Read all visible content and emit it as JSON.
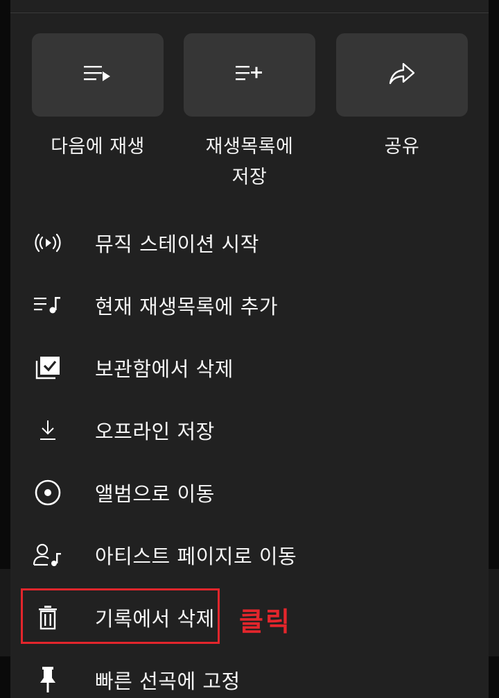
{
  "actions": [
    {
      "id": "play-next",
      "icon": "queue-play-icon",
      "label_lines": [
        "다음에 재생"
      ]
    },
    {
      "id": "save-playlist",
      "icon": "playlist-add-icon",
      "label_lines": [
        "재생목록에",
        "저장"
      ]
    },
    {
      "id": "share",
      "icon": "share-icon",
      "label_lines": [
        "공유"
      ]
    }
  ],
  "menu": [
    {
      "id": "start-radio",
      "icon": "radio-icon",
      "label": "뮤직 스테이션 시작"
    },
    {
      "id": "add-to-queue",
      "icon": "queue-music-icon",
      "label": "현재 재생목록에 추가"
    },
    {
      "id": "remove-library",
      "icon": "library-check-icon",
      "label": "보관함에서 삭제"
    },
    {
      "id": "download",
      "icon": "download-icon",
      "label": "오프라인 저장"
    },
    {
      "id": "go-album",
      "icon": "album-icon",
      "label": "앨범으로 이동"
    },
    {
      "id": "go-artist",
      "icon": "artist-icon",
      "label": "아티스트 페이지로 이동"
    },
    {
      "id": "remove-history",
      "icon": "trash-icon",
      "label": "기록에서 삭제"
    },
    {
      "id": "pin-speed-dial",
      "icon": "pin-icon",
      "label": "빠른 선곡에 고정"
    }
  ],
  "annotation": {
    "text": "클릭",
    "color": "#e3262c"
  },
  "colors": {
    "sheet": "#212121",
    "tile": "#363636",
    "text": "#f5f5f5"
  }
}
